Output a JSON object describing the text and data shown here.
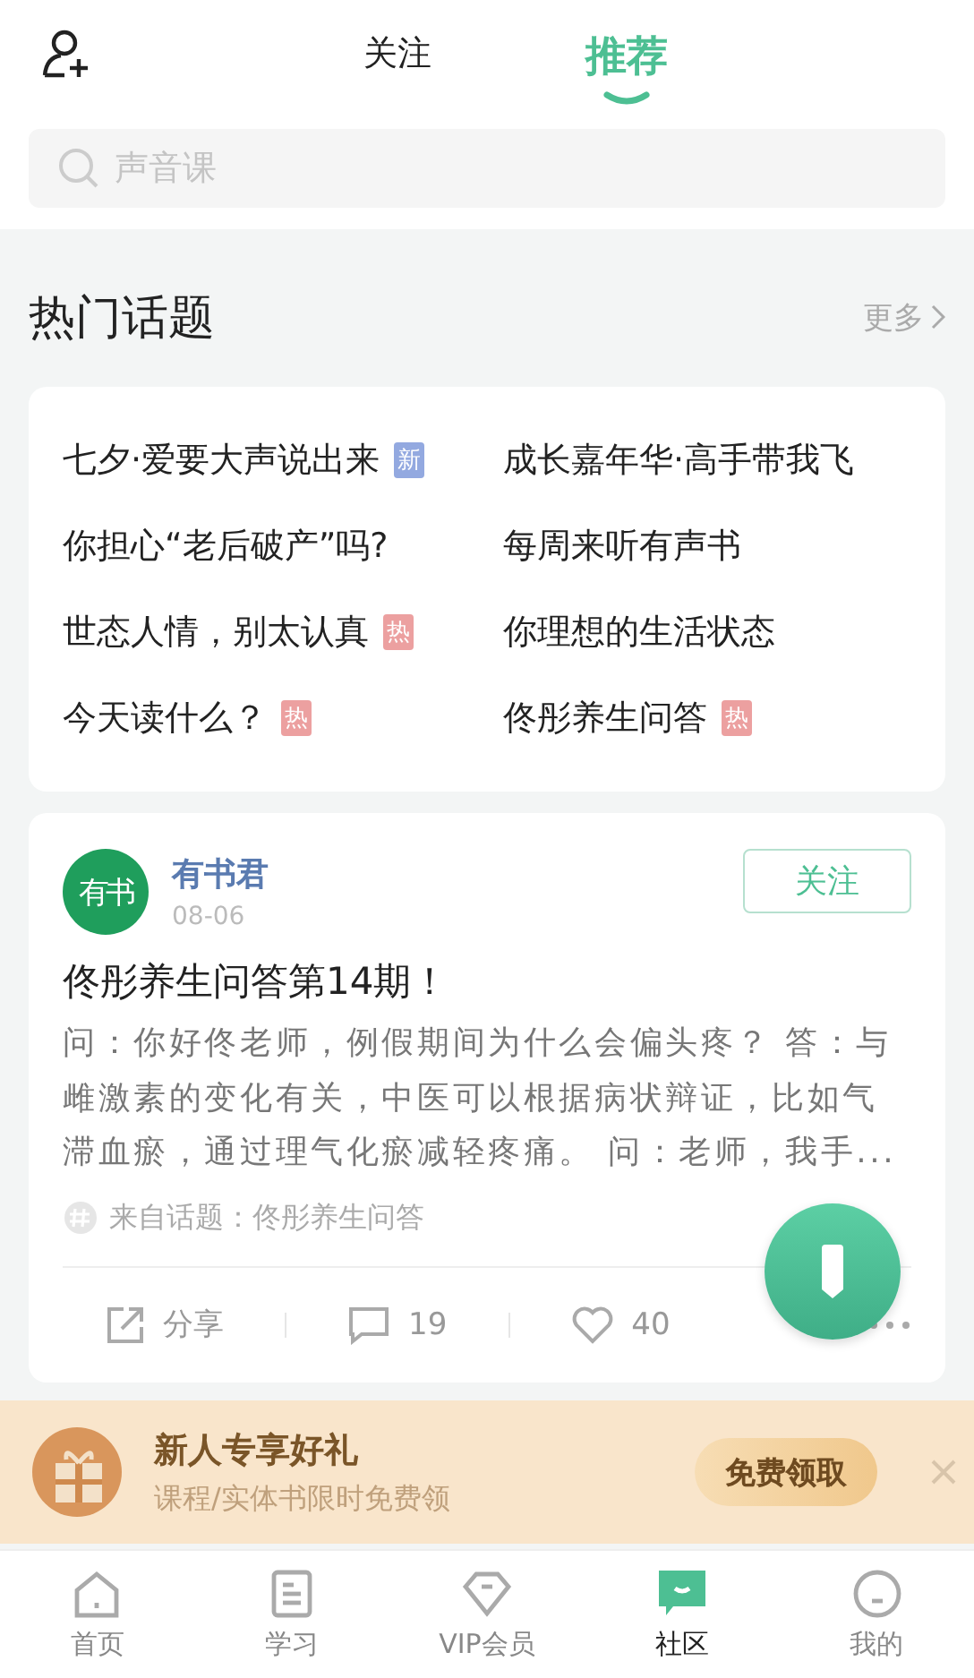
{
  "header": {
    "tabs": [
      {
        "label": "关注",
        "selected": false
      },
      {
        "label": "推荐",
        "selected": true
      }
    ]
  },
  "search": {
    "placeholder": "声音课"
  },
  "hot_topics": {
    "title": "热门话题",
    "more": "更多",
    "items": [
      {
        "text": "七夕·爱要大声说出来",
        "tag": {
          "kind": "new",
          "label": "新"
        }
      },
      {
        "text": "成长嘉年华·高手带我飞"
      },
      {
        "text": "你担心“老后破产”吗?"
      },
      {
        "text": "每周来听有声书"
      },
      {
        "text": "世态人情，别太认真",
        "tag": {
          "kind": "hot",
          "label": "热"
        }
      },
      {
        "text": "你理想的生活状态"
      },
      {
        "text": "今天读什么？",
        "tag": {
          "kind": "hot",
          "label": "热"
        }
      },
      {
        "text": "佟彤养生问答",
        "tag": {
          "kind": "hot",
          "label": "热"
        }
      }
    ]
  },
  "post": {
    "avatar_label": "有书",
    "author": "有书君",
    "date": "08-06",
    "follow": "关注",
    "title": "佟彤养生问答第14期！",
    "body": "问：你好佟老师，例假期间为什么会偏头疼？ 答：与雌激素的变化有关，中医可以根据病状辩证，比如气滞血瘀，通过理气化瘀减轻疼痛。 问：老师，我手...",
    "source": "来自话题：佟彤养生问答",
    "share": "分享",
    "comments": "19",
    "likes": "40"
  },
  "promo": {
    "title": "新人专享好礼",
    "subtitle": "课程/实体书限时免费领",
    "action": "免费领取"
  },
  "nav": [
    {
      "label": "首页",
      "selected": false
    },
    {
      "label": "学习",
      "selected": false
    },
    {
      "label": "VIP会员",
      "selected": false
    },
    {
      "label": "社区",
      "selected": true
    },
    {
      "label": "我的",
      "selected": false
    }
  ]
}
